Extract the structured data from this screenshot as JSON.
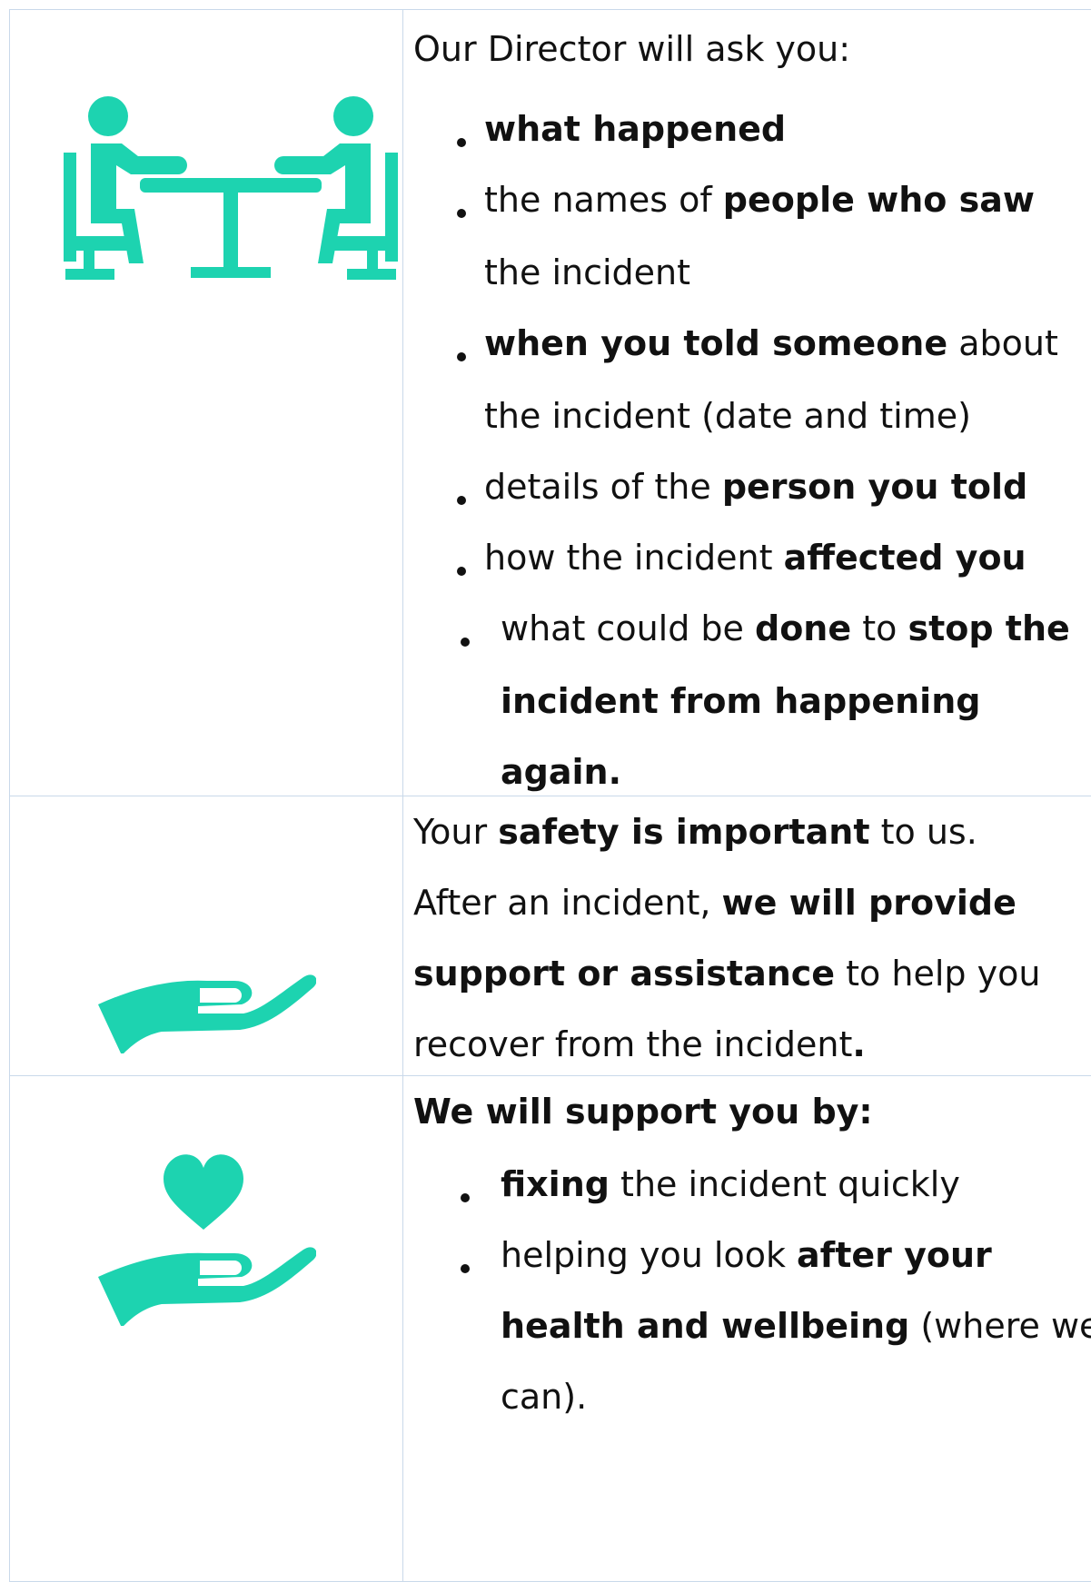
{
  "colors": {
    "icon": "#1dd3b0",
    "border": "#c9d9ea",
    "text": "#111111"
  },
  "rows": [
    {
      "icon": "meeting-icon",
      "intro": "Our Director will ask you:",
      "bullets": {
        "b1": "what happened",
        "b2_a": "the  names  of  ",
        "b2_b": "people  who  saw",
        "b2_c": "the incident",
        "b3_a": "when  you  told  someone",
        "b3_b": "  about",
        "b3_c": "the incident (date and time)",
        "b4_a": "details of the ",
        "b4_b": "person you told",
        "b5_a": "how the incident ",
        "b5_b": "affected you",
        "b6_a": "what could be ",
        "b6_b": "done",
        "b6_c": " to ",
        "b6_d": "stop the",
        "b6_e": "incident from happening",
        "b6_f": "again."
      }
    },
    {
      "icon": "open-hand-icon",
      "l1_a": "Your ",
      "l1_b": "safety is important",
      "l1_c": " to us.",
      "l2_a": "After an incident, ",
      "l2_b": "we will provide",
      "l3_a": "support or assistance",
      "l3_b": " to help you",
      "l4_a": "recover from the incident",
      "l4_b": "."
    },
    {
      "icon": "heart-in-hand-icon",
      "heading": "We will support you by:",
      "b1_a": "fixing",
      "b1_b": " the incident quickly",
      "b2_a": "helping you look ",
      "b2_b": "after your",
      "b2_c": "health and wellbeing",
      "b2_d": " (where we",
      "b2_e": "can)."
    }
  ]
}
